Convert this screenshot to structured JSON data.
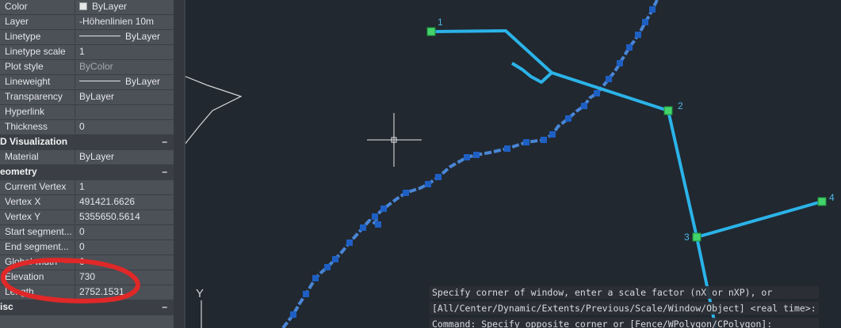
{
  "palette": {
    "rows": [
      {
        "type": "prop",
        "label": "Color",
        "value": "ByLayer",
        "decor": "swatch"
      },
      {
        "type": "prop",
        "label": "Layer",
        "value": "-Höhenlinien 10m"
      },
      {
        "type": "prop",
        "label": "Linetype",
        "value": "ByLayer",
        "decor": "line"
      },
      {
        "type": "prop",
        "label": "Linetype scale",
        "value": "1"
      },
      {
        "type": "prop",
        "label": "Plot style",
        "value": "ByColor",
        "dim": true
      },
      {
        "type": "prop",
        "label": "Lineweight",
        "value": "ByLayer",
        "decor": "line"
      },
      {
        "type": "prop",
        "label": "Transparency",
        "value": "ByLayer"
      },
      {
        "type": "prop",
        "label": "Hyperlink",
        "value": ""
      },
      {
        "type": "prop",
        "label": "Thickness",
        "value": "0"
      },
      {
        "type": "section",
        "title": "D Visualization",
        "toggle": "–"
      },
      {
        "type": "prop",
        "label": "Material",
        "value": "ByLayer"
      },
      {
        "type": "section",
        "title": "eometry",
        "toggle": "–"
      },
      {
        "type": "prop",
        "label": "Current Vertex",
        "value": "1"
      },
      {
        "type": "prop",
        "label": "Vertex X",
        "value": "491421.6626"
      },
      {
        "type": "prop",
        "label": "Vertex Y",
        "value": "5355650.5614"
      },
      {
        "type": "prop",
        "label": "Start  segment...",
        "value": "0"
      },
      {
        "type": "prop",
        "label": "End  segment...",
        "value": "0"
      },
      {
        "type": "prop",
        "label": "Global width",
        "value": "0"
      },
      {
        "type": "prop",
        "label": "Elevation",
        "value": "730"
      },
      {
        "type": "prop",
        "label": "Length",
        "value": "2752.1531"
      },
      {
        "type": "section",
        "title": "isc",
        "toggle": "–"
      }
    ]
  },
  "drawing": {
    "point_labels": [
      "1",
      "2",
      "3",
      "4"
    ],
    "ucs_axis_label": "Y",
    "colors": {
      "background": "#212830",
      "contour_line": "#4a86d6",
      "grip": "#1e5fc4",
      "polyline": "#2bb3e8",
      "vertex_grip": "#43d36a",
      "label": "#4fb6e6",
      "annotation": "#e02828"
    }
  },
  "command_line": {
    "lines": [
      "Specify corner of window, enter a scale factor (nX or nXP), or",
      "[All/Center/Dynamic/Extents/Previous/Scale/Window/Object] <real time>:",
      "Command: Specify opposite corner or [Fence/WPolygon/CPolygon]:"
    ]
  }
}
